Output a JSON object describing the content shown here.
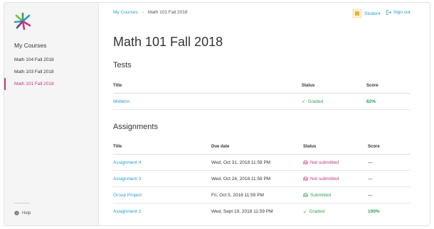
{
  "sidebar": {
    "heading": "My Courses",
    "items": [
      {
        "label": "Math 104 Fall 2018",
        "active": false
      },
      {
        "label": "Math 103 Fall 2018",
        "active": false
      },
      {
        "label": "Math 101 Fall 2018",
        "active": true
      }
    ],
    "help": "Help"
  },
  "topbar": {
    "breadcrumb": {
      "root": "My Courses",
      "current": "Math 101 Fall 2018"
    },
    "user_label": "Student",
    "signout_label": "Sign out"
  },
  "page_title": "Math 101 Fall 2018",
  "tests": {
    "title": "Tests",
    "columns": {
      "title": "Title",
      "status": "Status",
      "score": "Score"
    },
    "rows": [
      {
        "title": "Midterm",
        "status": "Graded",
        "score": "82%"
      }
    ]
  },
  "assignments": {
    "title": "Assignments",
    "columns": {
      "title": "Title",
      "due": "Due date",
      "status": "Status",
      "score": "Score"
    },
    "rows": [
      {
        "title": "Assignment 4",
        "due": "Wed, Oct 31, 2018 11:59 PM",
        "status": "Not submitted",
        "score": "—"
      },
      {
        "title": "Assignment 3",
        "due": "Wed, Oct 24, 2018 11:59 PM",
        "status": "Not submitted",
        "score": "—"
      },
      {
        "title": "Group Project",
        "due": "Fri, Oct 5, 2018 11:59 PM",
        "status": "Submitted",
        "score": "—"
      },
      {
        "title": "Assignment 2",
        "due": "Wed, Sept 19, 2018 11:59 PM",
        "status": "Graded",
        "score": "100%"
      }
    ]
  },
  "colors": {
    "accent": "#2a9dc8",
    "active": "#c7357d",
    "success": "#2ea25a"
  },
  "icons": [
    "logo-icon",
    "help-icon",
    "user-avatar-icon",
    "sign-out-icon",
    "check-icon",
    "inbox-icon"
  ]
}
